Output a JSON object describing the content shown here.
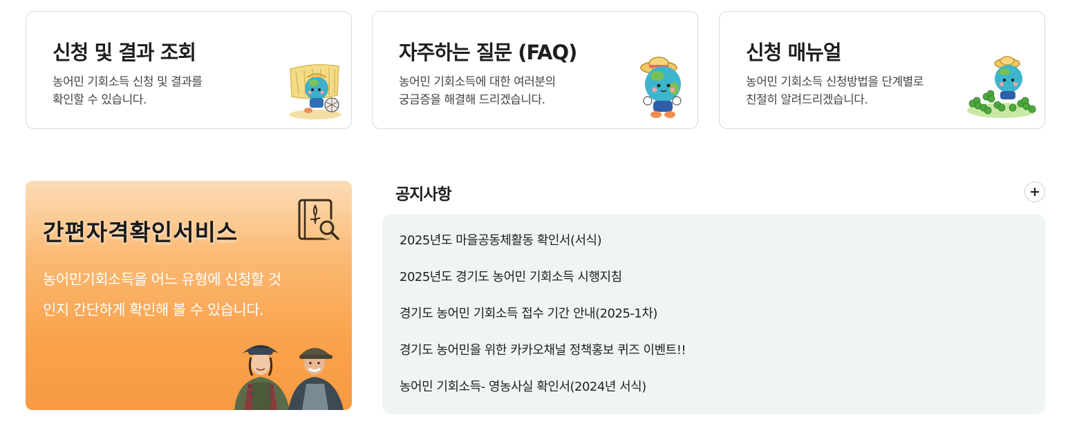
{
  "cards": [
    {
      "title": "신청 및 결과 조회",
      "desc_line1": "농어민 기회소득 신청 및 결과를",
      "desc_line2": "확인할 수 있습니다.",
      "icon": "mascot-with-hay-icon"
    },
    {
      "title": "자주하는 질문 (FAQ)",
      "desc_line1": "농어민 기회소득에 대한 여러분의",
      "desc_line2": "궁금증을 해결해 드리겠습니다.",
      "icon": "mascot-with-hat-icon"
    },
    {
      "title": "신청 매뉴얼",
      "desc_line1": "농어민 기회소득 신청방법을 단계별로",
      "desc_line2": "친절히 알려드리겠습니다.",
      "icon": "mascot-with-clover-icon"
    }
  ],
  "service": {
    "title": "간편자격확인서비스",
    "desc_line1": "농어민기회소득을 어느 유형에 신청할 것",
    "desc_line2": "인지 간단하게 확인해 볼 수 있습니다.",
    "icon": "document-search-icon",
    "photo": "farmers-photo"
  },
  "notices": {
    "title": "공지사항",
    "more_icon": "plus-icon",
    "items": [
      "2025년도 마을공동체활동 확인서(서식)",
      "2025년도 경기도 농어민 기회소득 시행지침",
      "경기도 농어민 기회소득 접수 기간 안내(2025-1차)",
      "경기도 농어민을 위한 카카오채널 정책홍보 퀴즈 이벤트!!",
      "농어민 기회소득- 영농사실 확인서(2024년 서식)"
    ]
  },
  "colors": {
    "service_gradient_top": "#fcdcb6",
    "service_gradient_bottom": "#f89a42",
    "notice_bg": "#eff5f5",
    "card_border": "#d9d9d9"
  }
}
